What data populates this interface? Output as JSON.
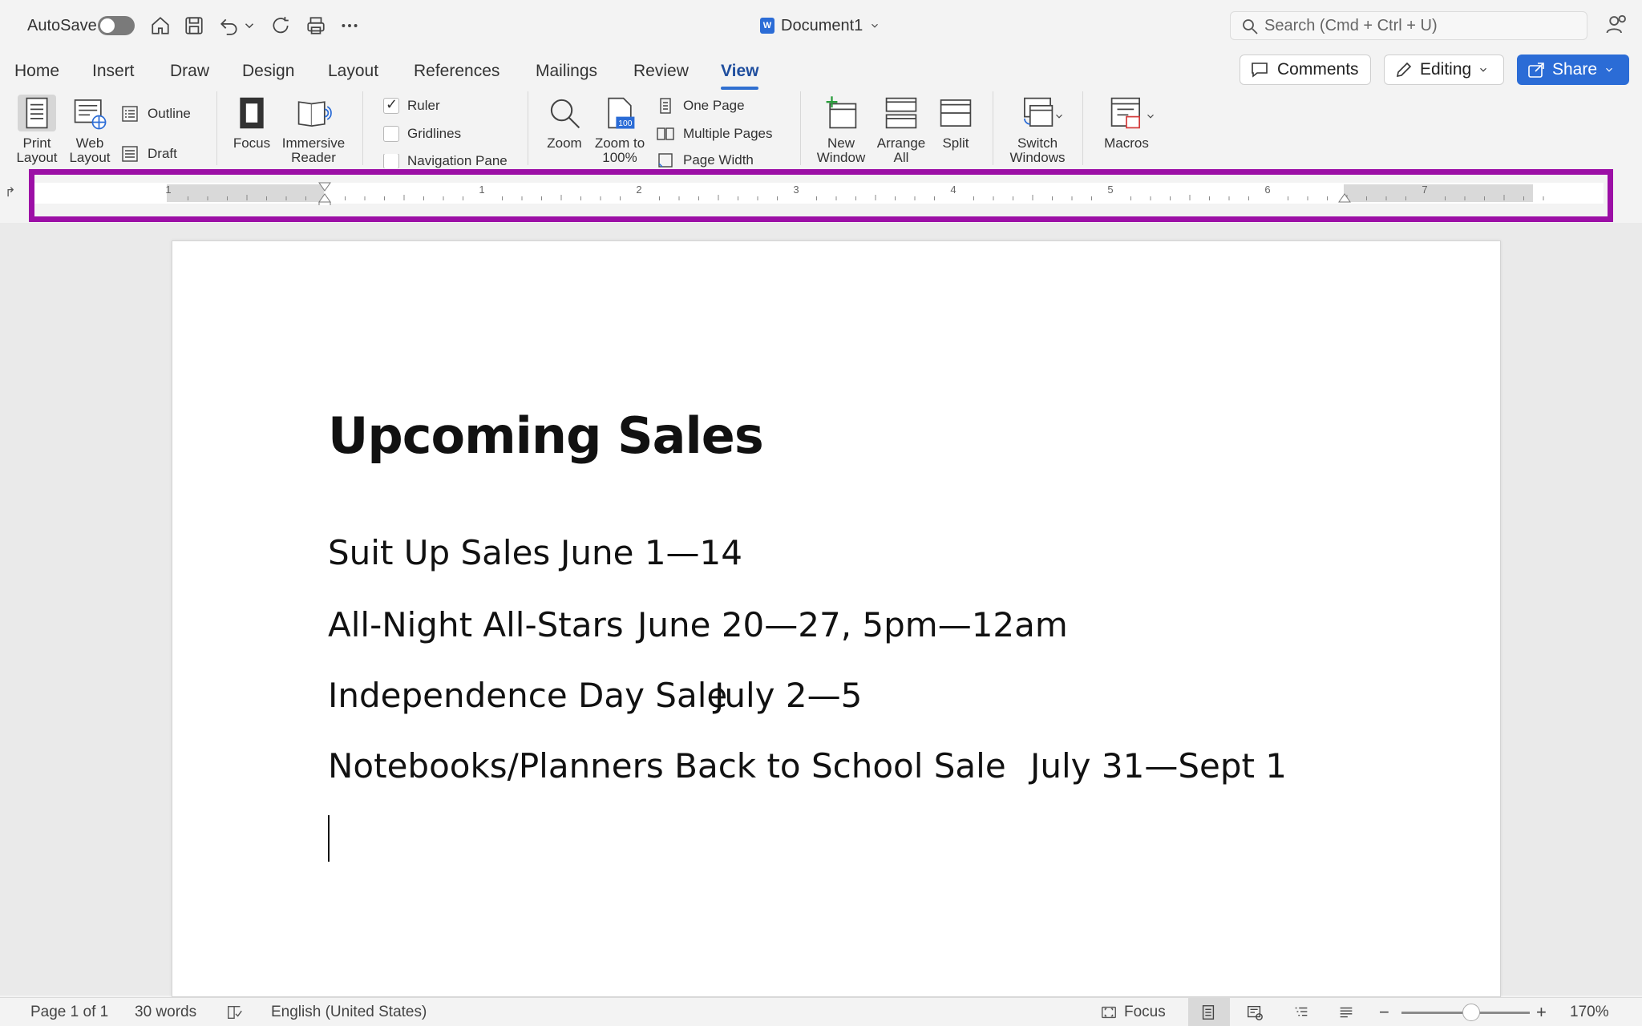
{
  "titlebar": {
    "autosave_label": "AutoSave",
    "doc_title": "Document1",
    "search_placeholder": "Search (Cmd + Ctrl + U)"
  },
  "tabs": [
    {
      "label": "Home"
    },
    {
      "label": "Insert"
    },
    {
      "label": "Draw"
    },
    {
      "label": "Design"
    },
    {
      "label": "Layout"
    },
    {
      "label": "References"
    },
    {
      "label": "Mailings"
    },
    {
      "label": "Review"
    },
    {
      "label": "View"
    }
  ],
  "active_tab": "View",
  "header_buttons": {
    "comments": "Comments",
    "editing": "Editing",
    "share": "Share"
  },
  "ribbon": {
    "print_layout": "Print Layout",
    "web_layout": "Web Layout",
    "outline": "Outline",
    "draft": "Draft",
    "focus": "Focus",
    "immersive_reader": "Immersive Reader",
    "ruler": "Ruler",
    "gridlines": "Gridlines",
    "navigation_pane": "Navigation Pane",
    "zoom": "Zoom",
    "zoom_100": "Zoom to 100%",
    "one_page": "One Page",
    "multiple_pages": "Multiple Pages",
    "page_width": "Page Width",
    "new_window": "New Window",
    "arrange_all": "Arrange All",
    "split": "Split",
    "switch_windows": "Switch Windows",
    "macros": "Macros"
  },
  "checkboxes": {
    "ruler": true,
    "gridlines": false,
    "navigation_pane": false
  },
  "ruler_numbers": [
    "1",
    "1",
    "2",
    "3",
    "4",
    "5",
    "6",
    "7"
  ],
  "document": {
    "heading": "Upcoming Sales",
    "lines": [
      {
        "name": "Suit Up Sales",
        "date": "June 1—14"
      },
      {
        "name": "All-Night All-Stars",
        "date": "June 20—27, 5pm—12am"
      },
      {
        "name": "Independence Day Sale",
        "date": "July 2—5"
      },
      {
        "name": "Notebooks/Planners Back to School Sale",
        "date": "July 31—Sept 1"
      }
    ]
  },
  "statusbar": {
    "page": "Page 1 of 1",
    "words": "30 words",
    "language": "English (United States)",
    "focus": "Focus",
    "zoom_level": "170%"
  },
  "colors": {
    "accent": "#2b6cd6",
    "highlight": "#9c0fa6"
  }
}
